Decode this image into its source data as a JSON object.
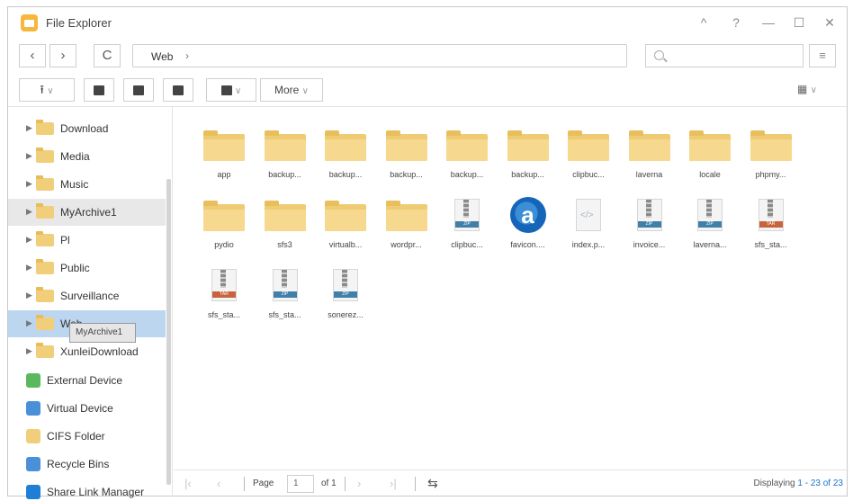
{
  "window": {
    "title": "File Explorer",
    "controls": {
      "pin": "^",
      "help": "?",
      "minimize": "—",
      "maximize": "☐",
      "close": "✕"
    }
  },
  "nav": {
    "back": "‹",
    "forward": "›",
    "refresh": "C",
    "path": "Web",
    "path_sep": "›",
    "search_placeholder": ""
  },
  "toolbar": {
    "more_label": "More"
  },
  "sidebar": {
    "folders": [
      {
        "label": "Download"
      },
      {
        "label": "Media"
      },
      {
        "label": "Music"
      },
      {
        "label": "MyArchive1"
      },
      {
        "label": "Pl"
      },
      {
        "label": "Public"
      },
      {
        "label": "Surveillance"
      },
      {
        "label": "Web"
      },
      {
        "label": "XunleiDownload"
      }
    ],
    "devices": [
      {
        "label": "External Device",
        "color": "#5cb85c"
      },
      {
        "label": "Virtual Device",
        "color": "#4a90d9"
      },
      {
        "label": "CIFS Folder",
        "color": "#f1cf7a"
      },
      {
        "label": "Recycle Bins",
        "color": "#4a90d9"
      },
      {
        "label": "Share Link Manager",
        "color": "#1f7fd6"
      }
    ],
    "tooltip": "MyArchive1",
    "selected_color": "#bcd6f0"
  },
  "files": [
    {
      "name": "app",
      "type": "folder"
    },
    {
      "name": "backup...",
      "type": "folder"
    },
    {
      "name": "backup...",
      "type": "folder"
    },
    {
      "name": "backup...",
      "type": "folder"
    },
    {
      "name": "backup...",
      "type": "folder"
    },
    {
      "name": "backup...",
      "type": "folder"
    },
    {
      "name": "clipbuc...",
      "type": "folder"
    },
    {
      "name": "laverna",
      "type": "folder"
    },
    {
      "name": "locale",
      "type": "folder"
    },
    {
      "name": "phpmy...",
      "type": "folder"
    },
    {
      "name": "pydio",
      "type": "folder"
    },
    {
      "name": "sfs3",
      "type": "folder"
    },
    {
      "name": "virtualb...",
      "type": "folder"
    },
    {
      "name": "wordpr...",
      "type": "folder"
    },
    {
      "name": "clipbuc...",
      "type": "zip",
      "ext": "ZIP",
      "band": "#3f7fa8"
    },
    {
      "name": "favicon....",
      "type": "favicon"
    },
    {
      "name": "index.p...",
      "type": "code"
    },
    {
      "name": "invoice...",
      "type": "zip",
      "ext": "ZIP",
      "band": "#3f7fa8"
    },
    {
      "name": "laverna...",
      "type": "zip",
      "ext": "ZIP",
      "band": "#3f7fa8"
    },
    {
      "name": "sfs_sta...",
      "type": "zip",
      "ext": "TAR",
      "band": "#c8643c"
    },
    {
      "name": "sfs_sta...",
      "type": "zip",
      "ext": "TAR",
      "band": "#c8643c"
    },
    {
      "name": "sfs_sta...",
      "type": "zip",
      "ext": "ZIP",
      "band": "#3f7fa8"
    },
    {
      "name": "sonerez...",
      "type": "zip",
      "ext": "ZIP",
      "band": "#3f7fa8"
    }
  ],
  "footer": {
    "page_label": "Page",
    "page_value": "1",
    "of_label": "of 1",
    "display_prefix": "Displaying",
    "display_range": "1 - 23",
    "display_of": "of",
    "display_total": "23"
  }
}
